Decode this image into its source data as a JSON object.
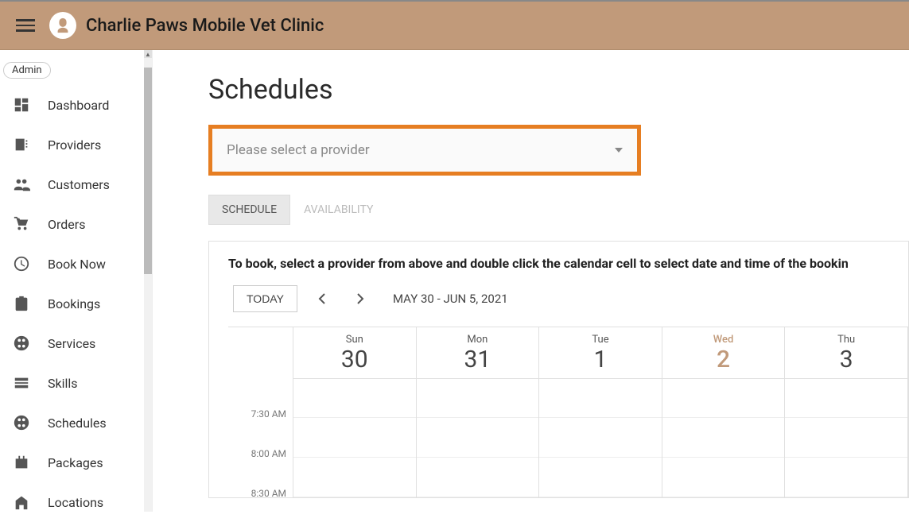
{
  "header": {
    "app_title": "Charlie Paws Mobile Vet Clinic"
  },
  "admin_badge": "Admin",
  "sidebar": {
    "items": [
      {
        "label": "Dashboard",
        "icon": "dashboard"
      },
      {
        "label": "Providers",
        "icon": "providers"
      },
      {
        "label": "Customers",
        "icon": "customers"
      },
      {
        "label": "Orders",
        "icon": "orders"
      },
      {
        "label": "Book Now",
        "icon": "booknow"
      },
      {
        "label": "Bookings",
        "icon": "bookings"
      },
      {
        "label": "Services",
        "icon": "services"
      },
      {
        "label": "Skills",
        "icon": "skills"
      },
      {
        "label": "Schedules",
        "icon": "schedules"
      },
      {
        "label": "Packages",
        "icon": "packages"
      },
      {
        "label": "Locations",
        "icon": "locations"
      }
    ]
  },
  "page": {
    "title": "Schedules",
    "provider_placeholder": "Please select a provider",
    "tabs": [
      {
        "label": "SCHEDULE",
        "active": true
      },
      {
        "label": "AVAILABILITY",
        "active": false
      }
    ],
    "instruction": "To book, select a provider from above and double click the calendar cell to select date and time of the bookin",
    "today_label": "TODAY",
    "date_range": "MAY 30 - JUN 5, 2021",
    "days": [
      {
        "name": "Sun",
        "num": "30",
        "today": false
      },
      {
        "name": "Mon",
        "num": "31",
        "today": false
      },
      {
        "name": "Tue",
        "num": "1",
        "today": false
      },
      {
        "name": "Wed",
        "num": "2",
        "today": true
      },
      {
        "name": "Thu",
        "num": "3",
        "today": false
      }
    ],
    "time_slots": [
      "7:30 AM",
      "8:00 AM",
      "8:30 AM"
    ]
  }
}
